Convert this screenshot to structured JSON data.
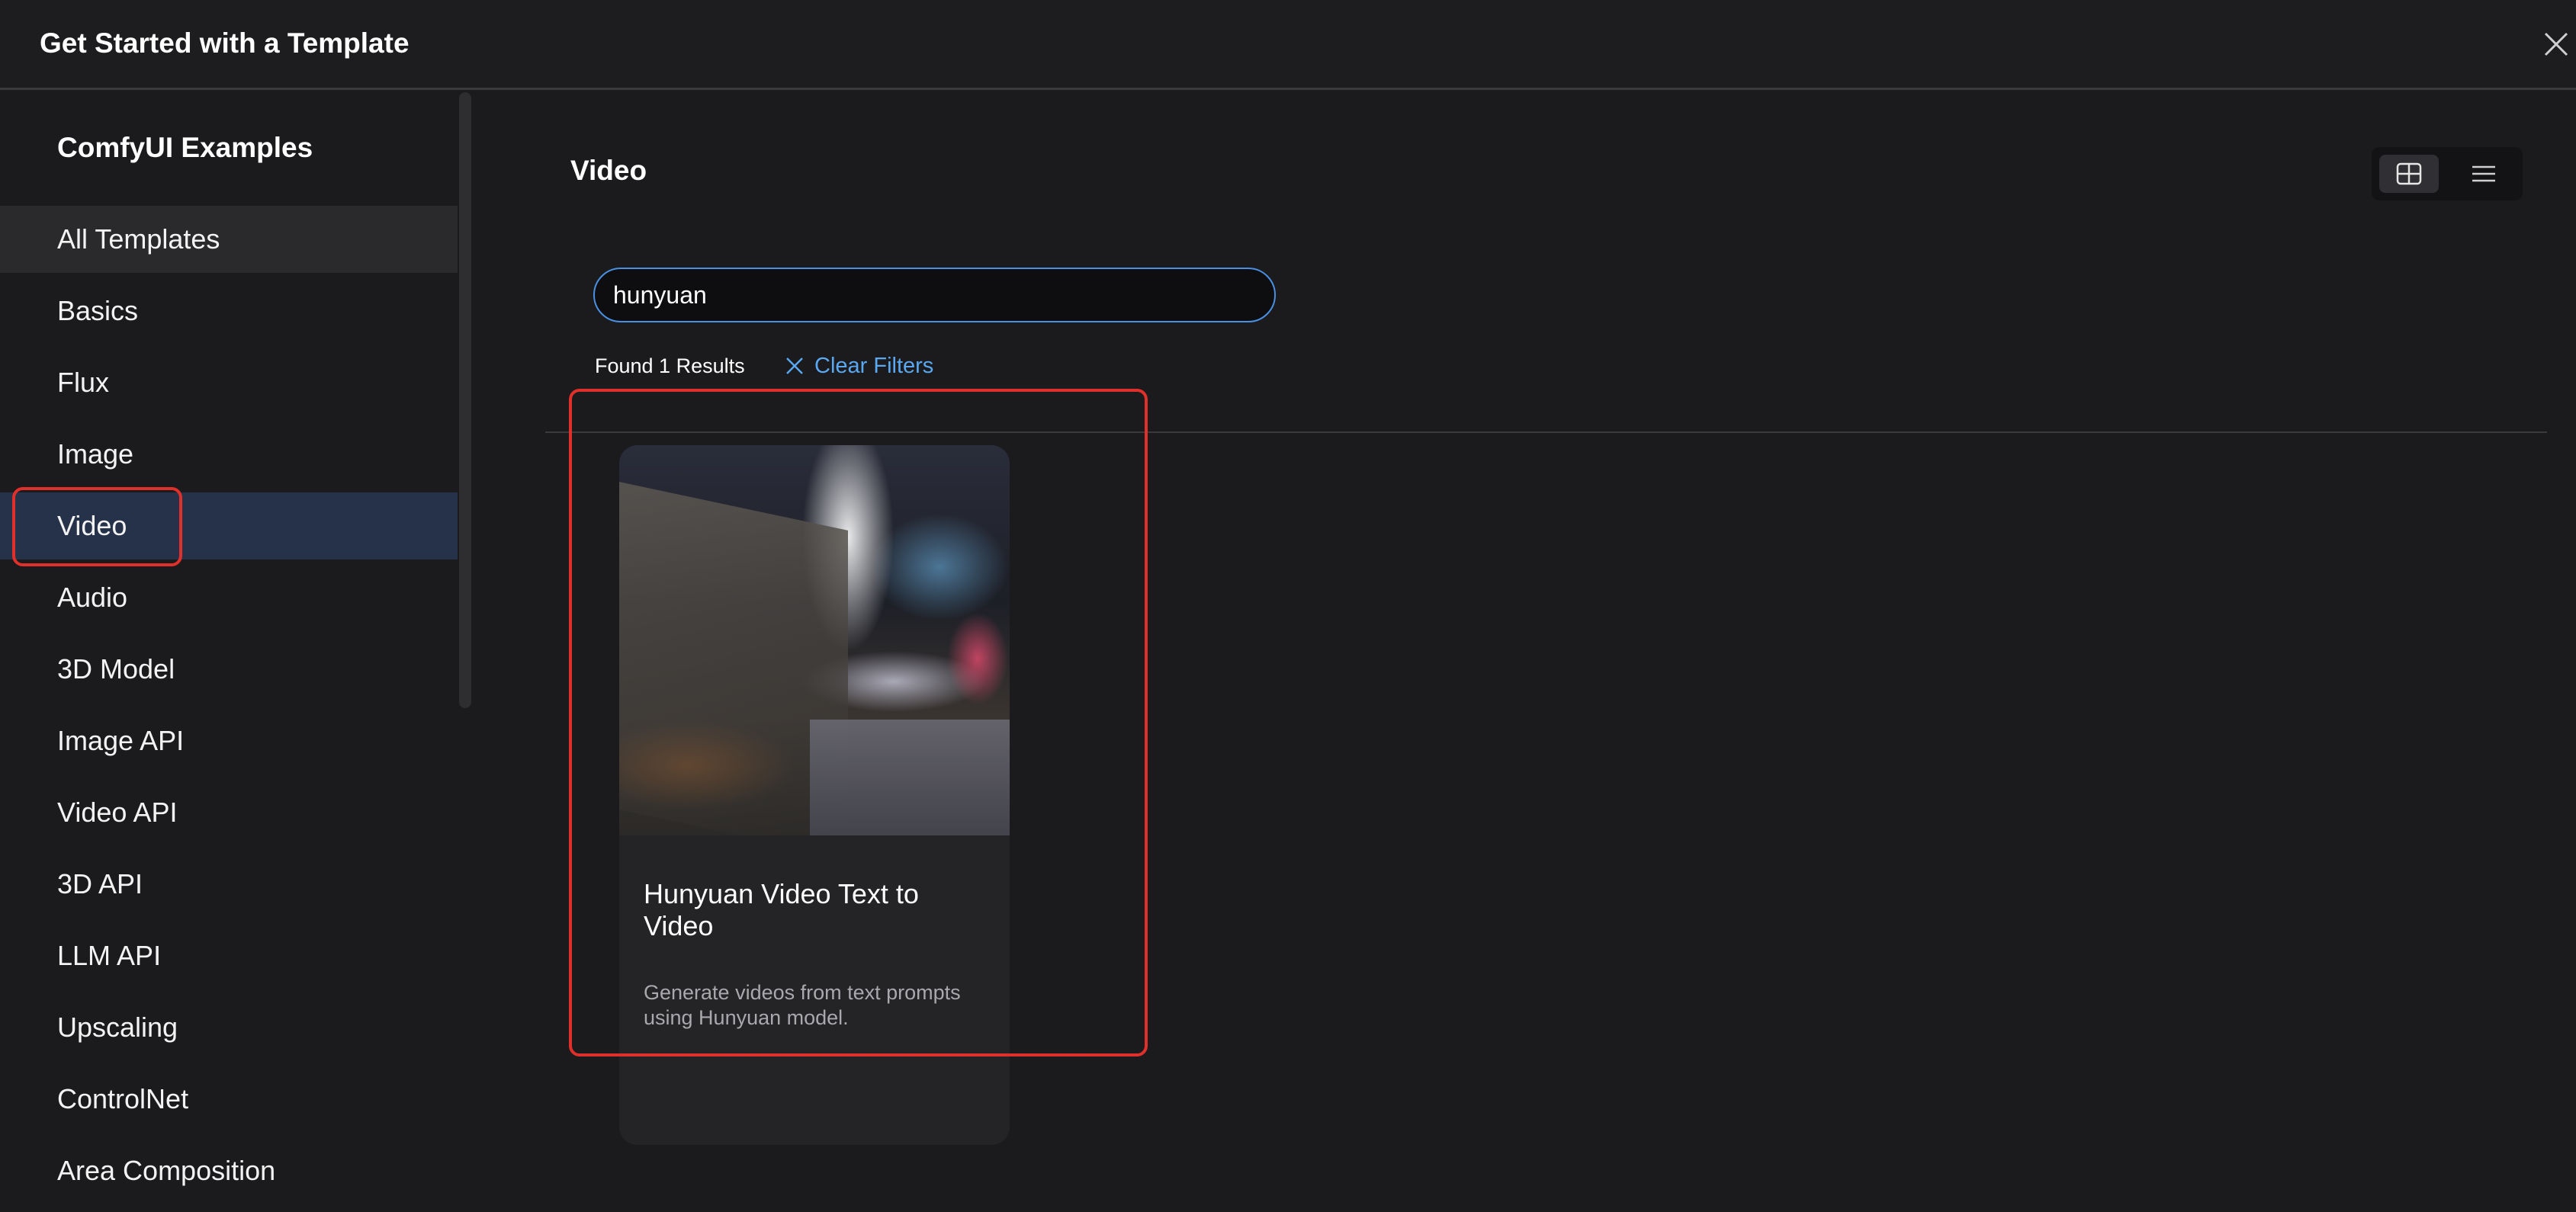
{
  "header": {
    "title": "Get Started with a Template"
  },
  "sidebar": {
    "title": "ComfyUI Examples",
    "items": [
      {
        "label": "All Templates"
      },
      {
        "label": "Basics"
      },
      {
        "label": "Flux"
      },
      {
        "label": "Image"
      },
      {
        "label": "Video"
      },
      {
        "label": "Audio"
      },
      {
        "label": "3D Model"
      },
      {
        "label": "Image API"
      },
      {
        "label": "Video API"
      },
      {
        "label": "3D API"
      },
      {
        "label": "LLM API"
      },
      {
        "label": "Upscaling"
      },
      {
        "label": "ControlNet"
      },
      {
        "label": "Area Composition"
      }
    ],
    "active_item": "Video",
    "hovered_item": "All Templates"
  },
  "main": {
    "section_title": "Video",
    "view_modes": [
      "grid",
      "list"
    ],
    "selected_view": "grid",
    "search": {
      "value": "hunyuan"
    },
    "results_text": "Found 1 Results",
    "clear_filters_label": "Clear Filters",
    "cards": [
      {
        "title": "Hunyuan Video Text to Video",
        "description": "Generate videos from text prompts using Hunyuan model.",
        "thumbnail": "night city street scene"
      }
    ]
  },
  "colors": {
    "background": "#1b1b1d",
    "active_nav": "#26324a",
    "accent": "#5aa8f2",
    "input_border": "#4a90e2",
    "highlight": "#e0302b"
  }
}
